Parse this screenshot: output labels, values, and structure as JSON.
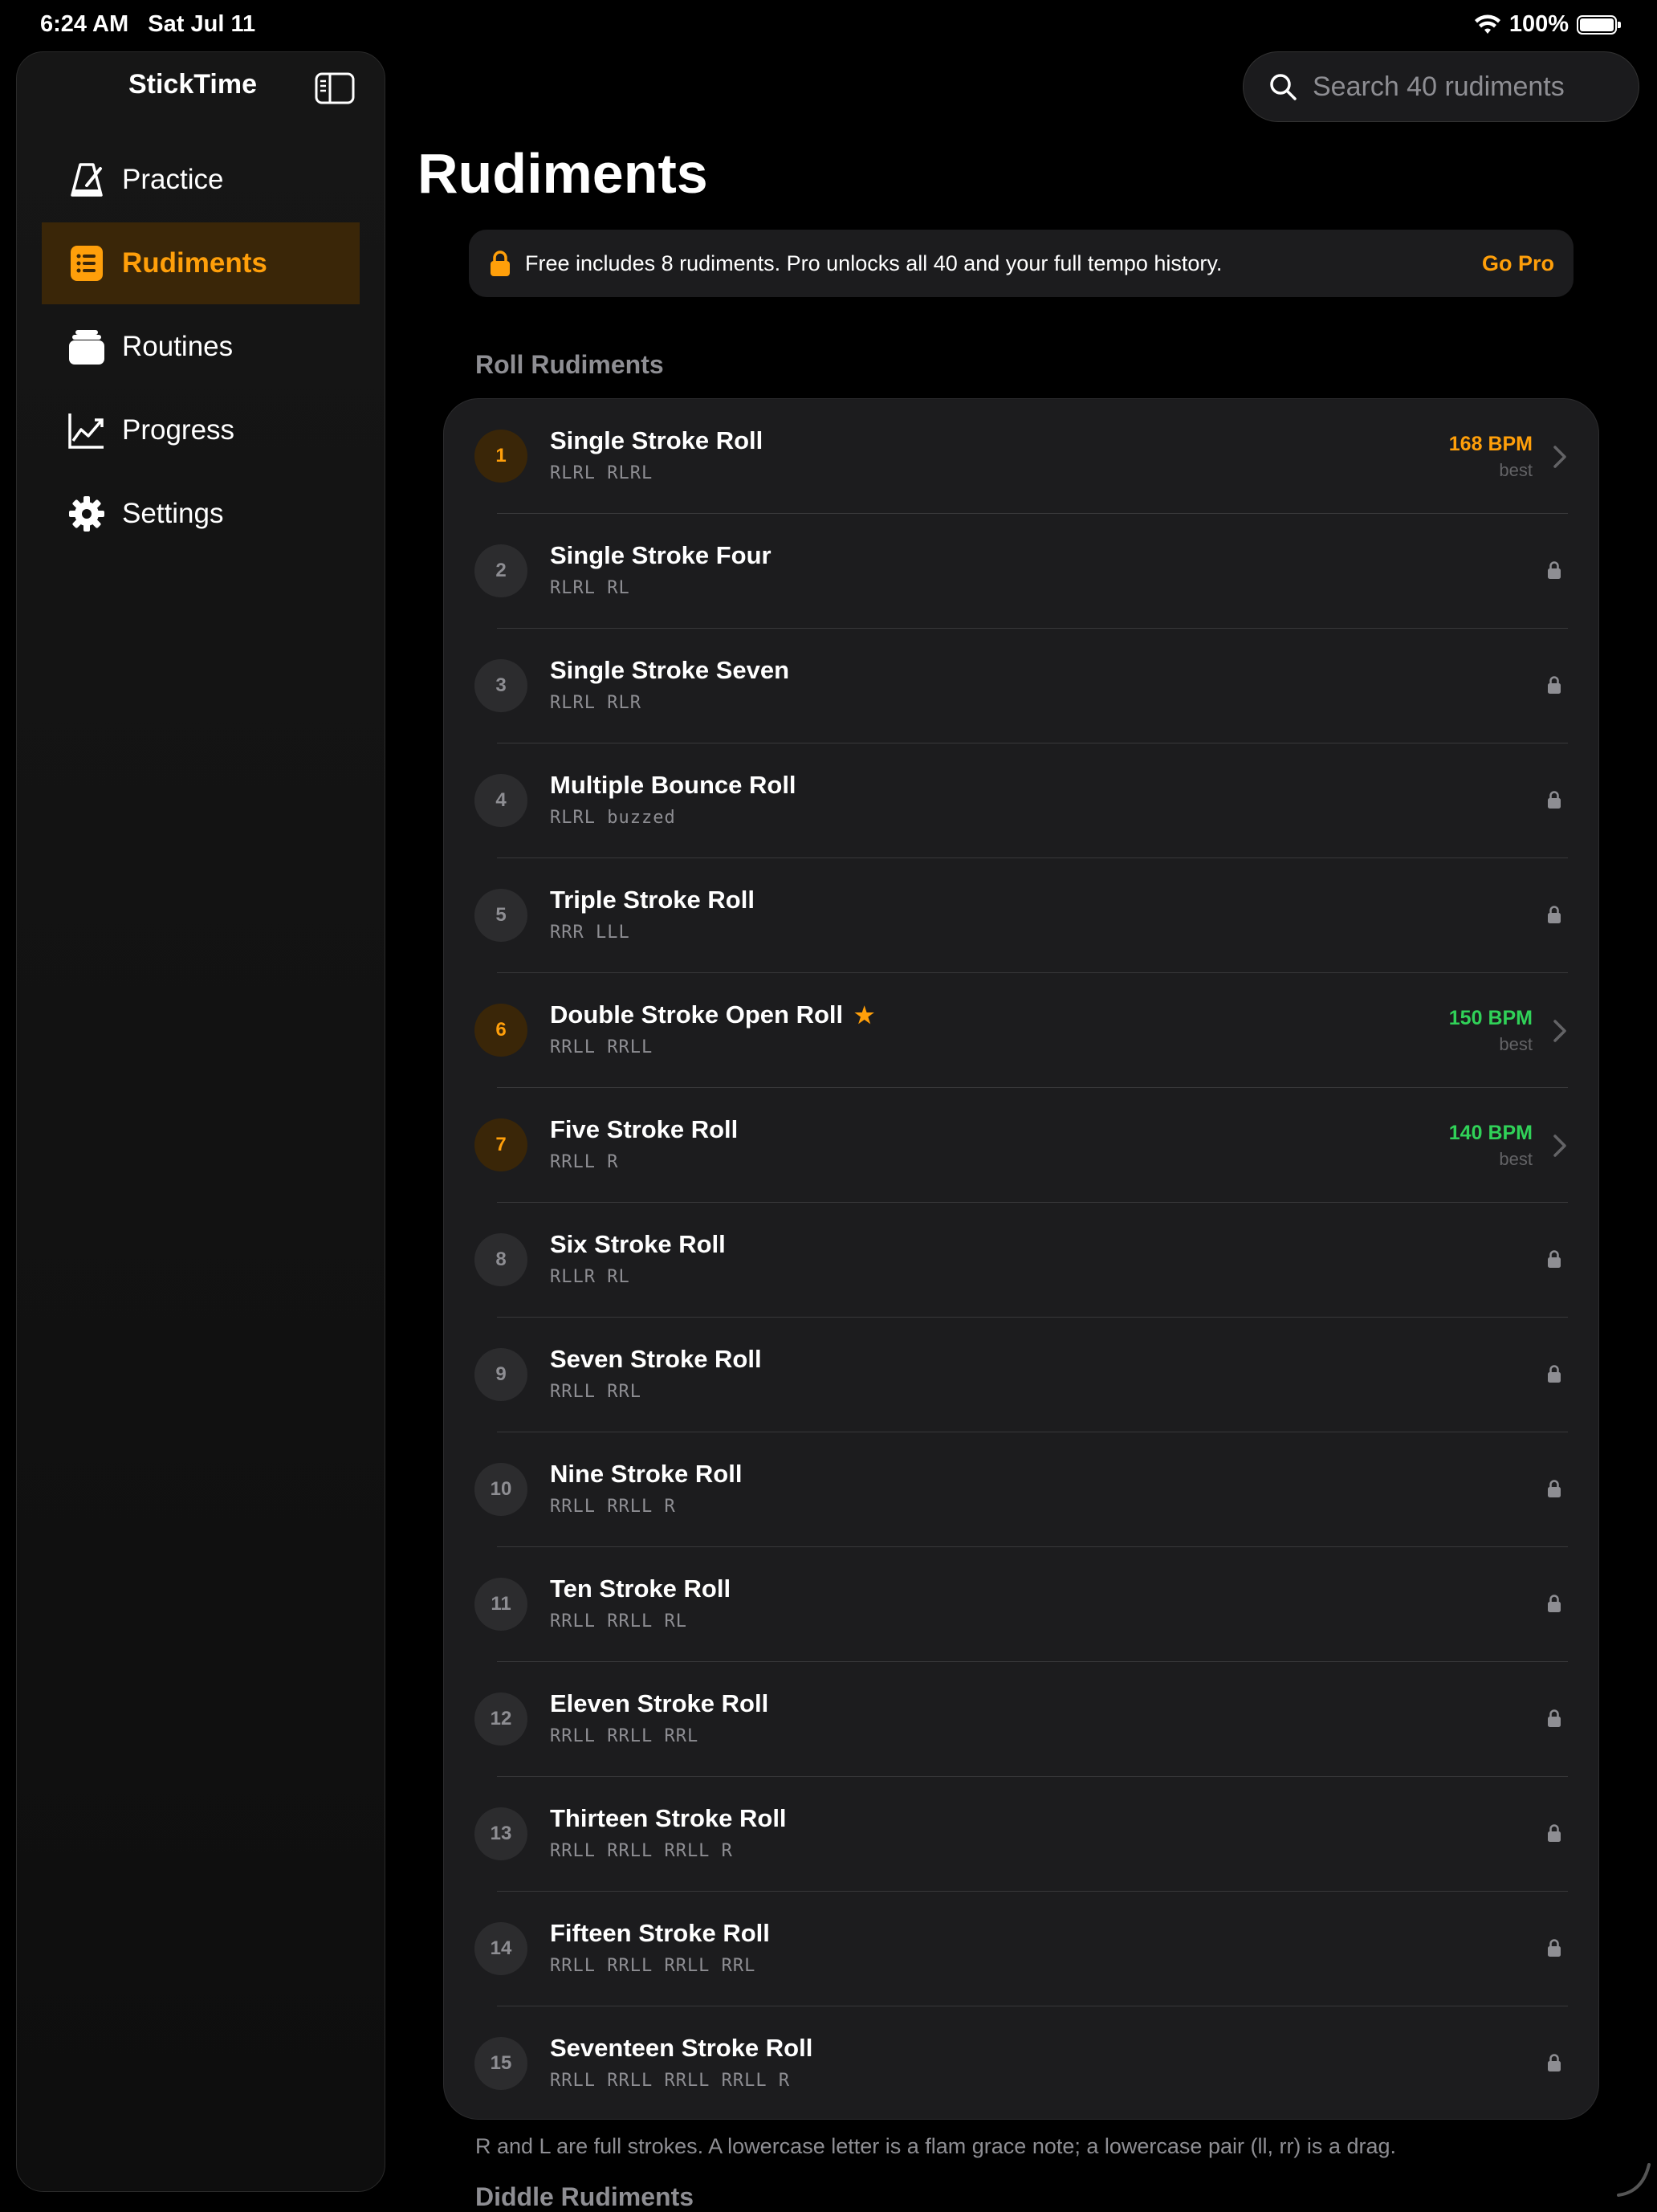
{
  "status_bar": {
    "time": "6:24 AM",
    "date": "Sat Jul 11",
    "battery": "100%",
    "battery_level": 1.0
  },
  "sidebar": {
    "app_title": "StickTime",
    "toggle_icon": "sidebar-toggle-icon",
    "items": [
      {
        "label": "Practice",
        "icon": "metronome-icon",
        "active": false
      },
      {
        "label": "Rudiments",
        "icon": "list-icon",
        "active": true
      },
      {
        "label": "Routines",
        "icon": "stack-icon",
        "active": false
      },
      {
        "label": "Progress",
        "icon": "chart-icon",
        "active": false
      },
      {
        "label": "Settings",
        "icon": "gear-icon",
        "active": false
      }
    ]
  },
  "search": {
    "placeholder": "Search 40 rudiments"
  },
  "page": {
    "title": "Rudiments"
  },
  "banner": {
    "icon": "lock-icon",
    "text": "Free includes 8 rudiments. Pro unlocks all 40 and your full tempo history.",
    "button": "Go Pro"
  },
  "sections": {
    "roll": "Roll Rudiments",
    "diddle": "Diddle Rudiments"
  },
  "rudiments": [
    {
      "number": "1",
      "name": "Single Stroke Roll",
      "sticking": "RLRL RLRL",
      "unlocked": true,
      "bpm": "168 BPM",
      "bpm_caption": "best",
      "bpm_color": "#ff9f0a",
      "starred": false
    },
    {
      "number": "2",
      "name": "Single Stroke Four",
      "sticking": "RLRL RL",
      "unlocked": false
    },
    {
      "number": "3",
      "name": "Single Stroke Seven",
      "sticking": "RLRL RLR",
      "unlocked": false
    },
    {
      "number": "4",
      "name": "Multiple Bounce Roll",
      "sticking": "RLRL buzzed",
      "unlocked": false
    },
    {
      "number": "5",
      "name": "Triple Stroke Roll",
      "sticking": "RRR LLL",
      "unlocked": false
    },
    {
      "number": "6",
      "name": "Double Stroke Open Roll",
      "sticking": "RRLL RRLL",
      "unlocked": true,
      "bpm": "150 BPM",
      "bpm_caption": "best",
      "bpm_color": "#30d158",
      "starred": true
    },
    {
      "number": "7",
      "name": "Five Stroke Roll",
      "sticking": "RRLL R",
      "unlocked": true,
      "bpm": "140 BPM",
      "bpm_caption": "best",
      "bpm_color": "#30d158",
      "starred": false
    },
    {
      "number": "8",
      "name": "Six Stroke Roll",
      "sticking": "RLLR RL",
      "unlocked": false
    },
    {
      "number": "9",
      "name": "Seven Stroke Roll",
      "sticking": "RRLL RRL",
      "unlocked": false
    },
    {
      "number": "10",
      "name": "Nine Stroke Roll",
      "sticking": "RRLL RRLL R",
      "unlocked": false
    },
    {
      "number": "11",
      "name": "Ten Stroke Roll",
      "sticking": "RRLL RRLL RL",
      "unlocked": false
    },
    {
      "number": "12",
      "name": "Eleven Stroke Roll",
      "sticking": "RRLL RRLL RRL",
      "unlocked": false
    },
    {
      "number": "13",
      "name": "Thirteen Stroke Roll",
      "sticking": "RRLL RRLL RRLL R",
      "unlocked": false
    },
    {
      "number": "14",
      "name": "Fifteen Stroke Roll",
      "sticking": "RRLL RRLL RRLL RRL",
      "unlocked": false
    },
    {
      "number": "15",
      "name": "Seventeen Stroke Roll",
      "sticking": "RRLL RRLL RRLL RRLL R",
      "unlocked": false
    }
  ],
  "footnote": "R and L are full strokes. A lowercase letter is a flam grace note; a lowercase pair (ll, rr) is a drag.",
  "colors": {
    "accent": "#ff9f0a",
    "success": "#30d158",
    "background": "#000000",
    "card": "#1c1c1e"
  }
}
